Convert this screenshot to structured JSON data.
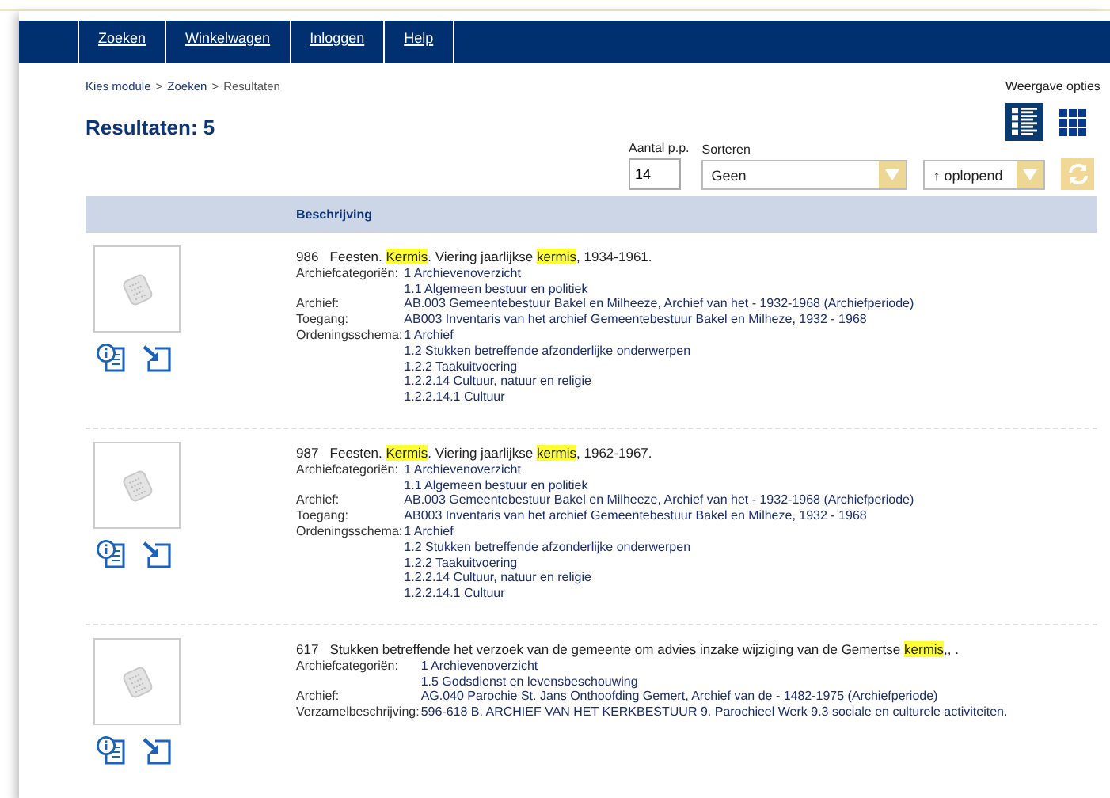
{
  "nav": [
    {
      "label": "Zoeken"
    },
    {
      "label": "Winkelwagen"
    },
    {
      "label": "Inloggen"
    },
    {
      "label": "Help"
    }
  ],
  "breadcrumb_separator": ">",
  "breadcrumb": [
    {
      "label": "Kies module",
      "link": true
    },
    {
      "label": "Zoeken",
      "link": true
    },
    {
      "label": "Resultaten",
      "link": false
    }
  ],
  "heading": "Resultaten: 5",
  "view_options": {
    "label": "Weergave opties",
    "views": [
      {
        "kind": "list",
        "selected": true
      },
      {
        "kind": "grid",
        "selected": false
      }
    ]
  },
  "per_page": {
    "label": "Aantal p.p.",
    "value": "14"
  },
  "sort": {
    "label": "Sorteren",
    "value": "Geen",
    "order": "↑ oplopend"
  },
  "table": {
    "columns": [
      "Beschrijving"
    ]
  },
  "results": [
    {
      "number": "986",
      "title": [
        {
          "text": "Feesten. ",
          "highlight": false
        },
        {
          "text": "Kermis",
          "highlight": true
        },
        {
          "text": ". Viering jaarlijkse ",
          "highlight": false
        },
        {
          "text": "kermis",
          "highlight": true
        },
        {
          "text": ", 1934-1961.",
          "highlight": false
        }
      ],
      "fields": [
        {
          "label": "Archiefcategoriën:",
          "values": [
            "1 Archievenoverzicht",
            "1.1 Algemeen bestuur en politiek"
          ]
        },
        {
          "label": "Archief:",
          "values": [
            "AB.003 Gemeentebestuur Bakel en Milheeze, Archief van het - 1932-1968 (Archiefperiode)"
          ]
        },
        {
          "label": "Toegang:",
          "values": [
            "AB003 Inventaris van het archief Gemeentebestuur Bakel en Milheze, 1932 - 1968"
          ]
        },
        {
          "label": "Ordeningsschema:",
          "values": [
            "1 Archief",
            "1.2 Stukken betreffende afzonderlijke onderwerpen",
            "1.2.2 Taakuitvoering",
            "1.2.2.14 Cultuur, natuur en religie",
            "1.2.2.14.1 Cultuur"
          ]
        }
      ]
    },
    {
      "number": "987",
      "title": [
        {
          "text": "Feesten. ",
          "highlight": false
        },
        {
          "text": "Kermis",
          "highlight": true
        },
        {
          "text": ". Viering jaarlijkse ",
          "highlight": false
        },
        {
          "text": "kermis",
          "highlight": true
        },
        {
          "text": ", 1962-1967.",
          "highlight": false
        }
      ],
      "fields": [
        {
          "label": "Archiefcategoriën:",
          "values": [
            "1 Archievenoverzicht",
            "1.1 Algemeen bestuur en politiek"
          ]
        },
        {
          "label": "Archief:",
          "values": [
            "AB.003 Gemeentebestuur Bakel en Milheeze, Archief van het - 1932-1968 (Archiefperiode)"
          ]
        },
        {
          "label": "Toegang:",
          "values": [
            "AB003 Inventaris van het archief Gemeentebestuur Bakel en Milheze, 1932 - 1968"
          ]
        },
        {
          "label": "Ordeningsschema:",
          "values": [
            "1 Archief",
            "1.2 Stukken betreffende afzonderlijke onderwerpen",
            "1.2.2 Taakuitvoering",
            "1.2.2.14 Cultuur, natuur en religie",
            "1.2.2.14.1 Cultuur"
          ]
        }
      ]
    },
    {
      "number": "617",
      "title": [
        {
          "text": "Stukken betreffende het verzoek van de gemeente om advies inzake wijziging van de Gemertse ",
          "highlight": false
        },
        {
          "text": "kermis",
          "highlight": true
        },
        {
          "text": ",, .",
          "highlight": false
        }
      ],
      "fields": [
        {
          "label": "Archiefcategoriën:",
          "values": [
            "1 Archievenoverzicht",
            "1.5 Godsdienst en levensbeschouwing"
          ]
        },
        {
          "label": "Archief:",
          "values": [
            "AG.040 Parochie St. Jans Onthoofding Gemert, Archief van de - 1482-1975 (Archiefperiode)"
          ]
        },
        {
          "label": "Verzamelbeschrijving:",
          "values": [
            "596-618 B. ARCHIEF VAN HET KERKBESTUUR 9. Parochieel Werk 9.3 sociale en culturele activiteiten."
          ]
        }
      ]
    }
  ]
}
